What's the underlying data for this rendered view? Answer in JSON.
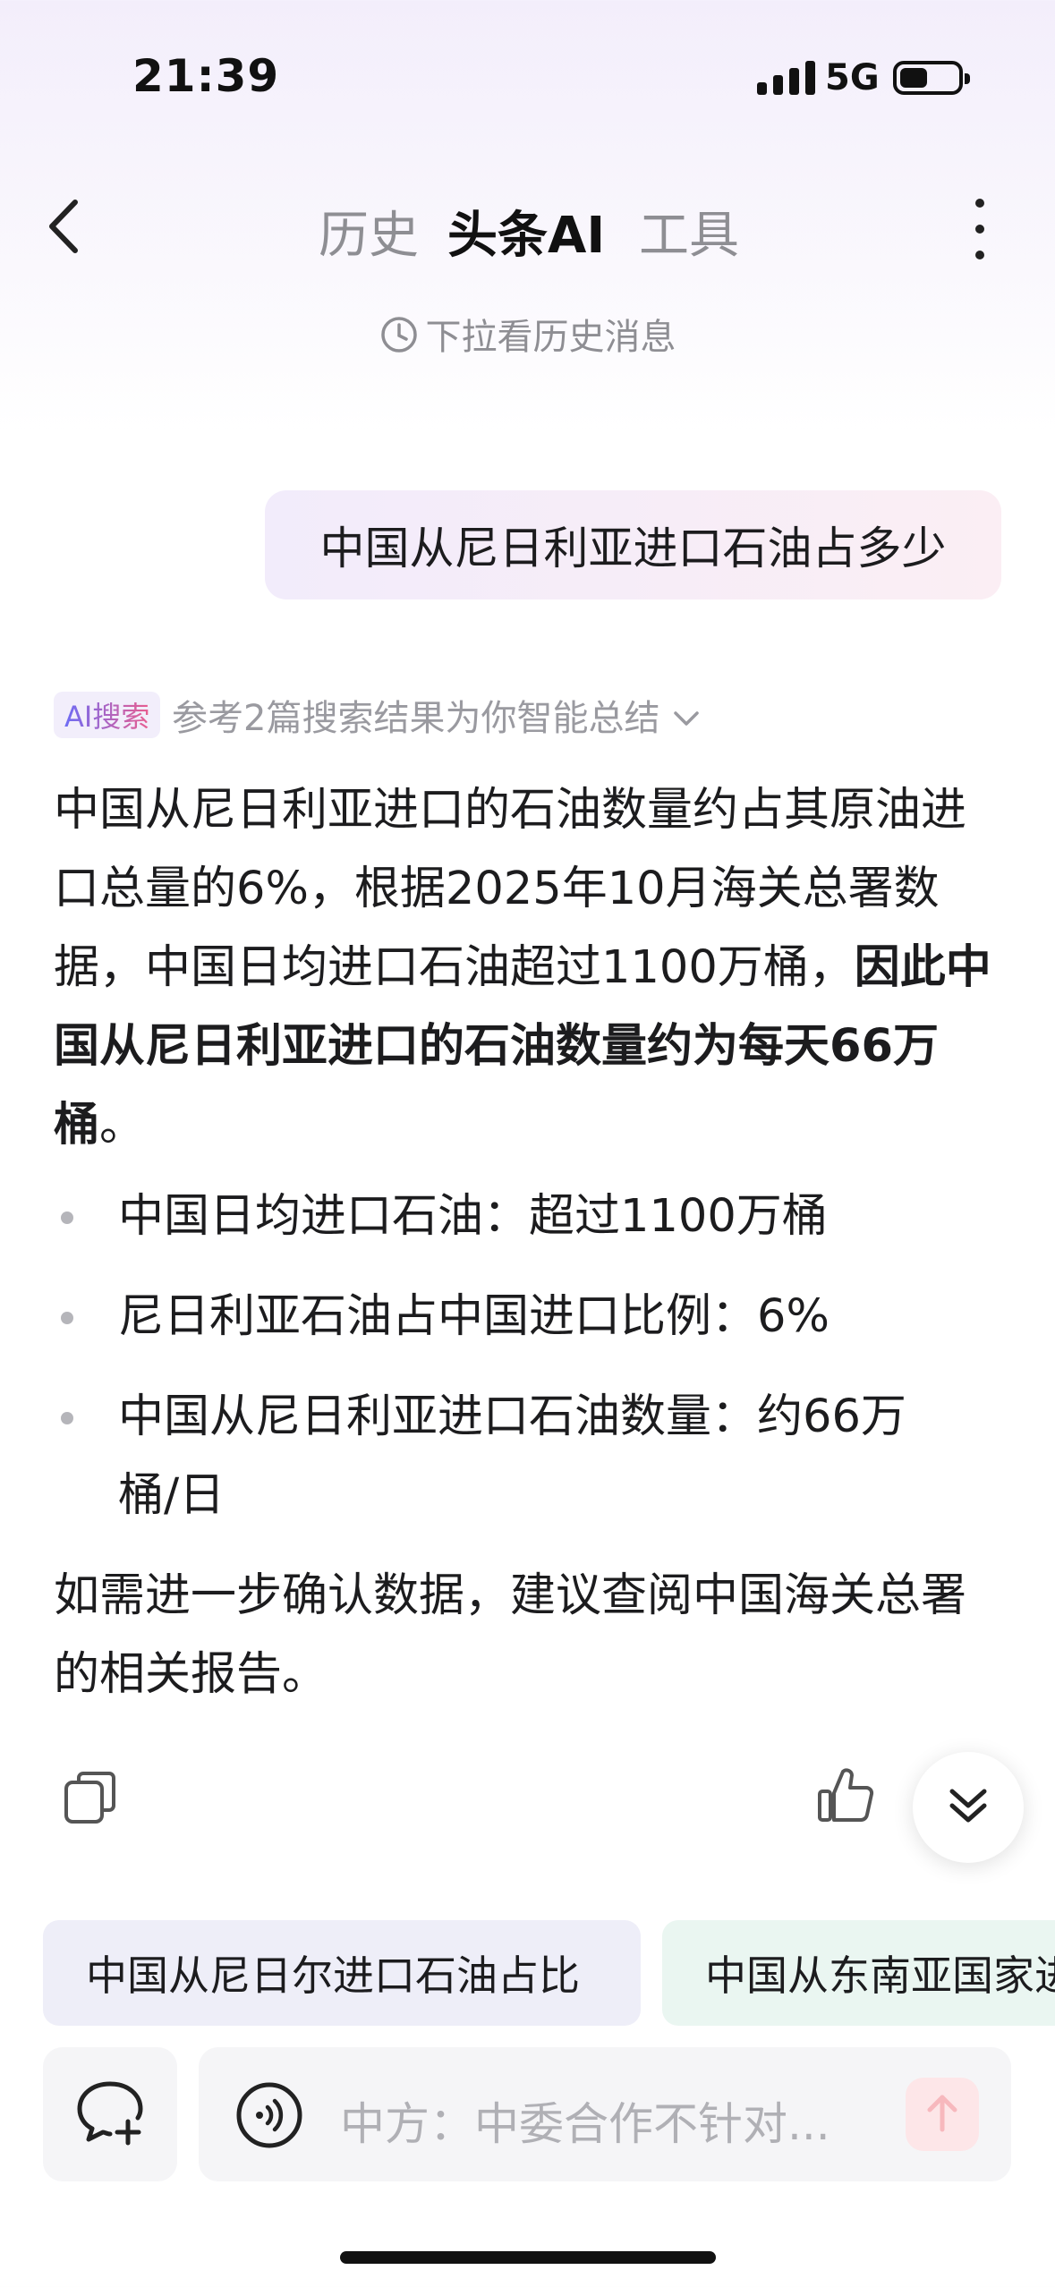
{
  "status_bar": {
    "time": "21:39",
    "network": "5G"
  },
  "nav": {
    "tabs": [
      "历史",
      "头条AI",
      "工具"
    ],
    "active_tab": "头条AI"
  },
  "pull_hint": "下拉看历史消息",
  "user_message": "中国从尼日利亚进口石油占多少",
  "ai_answer": {
    "badge": "AI搜索",
    "reference": "参考2篇搜索结果为你智能总结",
    "para_normal": "中国从尼日利亚进口的石油数量约占其原油进口总量的6%，根据2025年10月海关总署数据，中国日均进口石油超过1100万桶，",
    "para_bold": "因此中国从尼日利亚进口的石油数量约为每天66万桶",
    "para_end": "。",
    "bullets": [
      "中国日均进口石油：超过1100万桶",
      "尼日利亚石油占中国进口比例：6%",
      "中国从尼日利亚进口石油数量：约66万桶/日"
    ],
    "closing": "如需进一步确认数据，建议查阅中国海关总署的相关报告。"
  },
  "suggestions": [
    "中国从尼日尔进口石油占比",
    "中国从东南亚国家进"
  ],
  "input": {
    "placeholder": "中方：中委合作不针对..."
  },
  "colors": {
    "accent_gradient_start": "#6e6cf5",
    "accent_gradient_end": "#e95d8f",
    "chip1_bg": "#eeeef8",
    "chip2_bg": "#eaf6f1"
  }
}
